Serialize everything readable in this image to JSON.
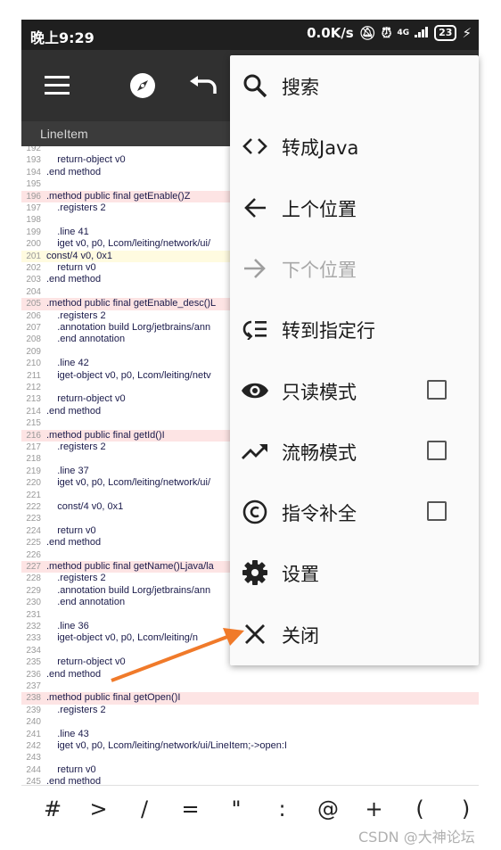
{
  "status": {
    "time": "晚上9:29",
    "speed": "0.0K/s",
    "network": "4G",
    "battery": "23"
  },
  "tab": {
    "label": "LineItem"
  },
  "code_lines": [
    {
      "n": "192",
      "t": "",
      "h": ""
    },
    {
      "n": "193",
      "t": "    return-object v0",
      "h": ""
    },
    {
      "n": "194",
      "t": ".end method",
      "h": ""
    },
    {
      "n": "195",
      "t": "",
      "h": ""
    },
    {
      "n": "196",
      "t": ".method public final getEnable()Z",
      "h": "pink"
    },
    {
      "n": "197",
      "t": "    .registers 2",
      "h": ""
    },
    {
      "n": "198",
      "t": "",
      "h": ""
    },
    {
      "n": "199",
      "t": "    .line 41",
      "h": ""
    },
    {
      "n": "200",
      "t": "    iget v0, p0, Lcom/leiting/network/ui/",
      "h": ""
    },
    {
      "n": "201",
      "t": "const/4 v0, 0x1",
      "h": "yellow"
    },
    {
      "n": "202",
      "t": "    return v0",
      "h": ""
    },
    {
      "n": "203",
      "t": ".end method",
      "h": ""
    },
    {
      "n": "204",
      "t": "",
      "h": ""
    },
    {
      "n": "205",
      "t": ".method public final getEnable_desc()L",
      "h": "pink"
    },
    {
      "n": "206",
      "t": "    .registers 2",
      "h": ""
    },
    {
      "n": "207",
      "t": "    .annotation build Lorg/jetbrains/ann",
      "h": ""
    },
    {
      "n": "208",
      "t": "    .end annotation",
      "h": ""
    },
    {
      "n": "209",
      "t": "",
      "h": ""
    },
    {
      "n": "210",
      "t": "    .line 42",
      "h": ""
    },
    {
      "n": "211",
      "t": "    iget-object v0, p0, Lcom/leiting/netv",
      "h": ""
    },
    {
      "n": "212",
      "t": "",
      "h": ""
    },
    {
      "n": "213",
      "t": "    return-object v0",
      "h": ""
    },
    {
      "n": "214",
      "t": ".end method",
      "h": ""
    },
    {
      "n": "215",
      "t": "",
      "h": ""
    },
    {
      "n": "216",
      "t": ".method public final getId()I",
      "h": "pink"
    },
    {
      "n": "217",
      "t": "    .registers 2",
      "h": ""
    },
    {
      "n": "218",
      "t": "",
      "h": ""
    },
    {
      "n": "219",
      "t": "    .line 37",
      "h": ""
    },
    {
      "n": "220",
      "t": "    iget v0, p0, Lcom/leiting/network/ui/",
      "h": ""
    },
    {
      "n": "221",
      "t": "",
      "h": ""
    },
    {
      "n": "222",
      "t": "    const/4 v0, 0x1",
      "h": ""
    },
    {
      "n": "223",
      "t": "",
      "h": ""
    },
    {
      "n": "224",
      "t": "    return v0",
      "h": ""
    },
    {
      "n": "225",
      "t": ".end method",
      "h": ""
    },
    {
      "n": "226",
      "t": "",
      "h": ""
    },
    {
      "n": "227",
      "t": ".method public final getName()Ljava/la",
      "h": "pink"
    },
    {
      "n": "228",
      "t": "    .registers 2",
      "h": ""
    },
    {
      "n": "229",
      "t": "    .annotation build Lorg/jetbrains/ann",
      "h": ""
    },
    {
      "n": "230",
      "t": "    .end annotation",
      "h": ""
    },
    {
      "n": "231",
      "t": "",
      "h": ""
    },
    {
      "n": "232",
      "t": "    .line 36",
      "h": ""
    },
    {
      "n": "233",
      "t": "    iget-object v0, p0, Lcom/leiting/n",
      "h": ""
    },
    {
      "n": "234",
      "t": "",
      "h": ""
    },
    {
      "n": "235",
      "t": "    return-object v0",
      "h": ""
    },
    {
      "n": "236",
      "t": ".end method",
      "h": ""
    },
    {
      "n": "237",
      "t": "",
      "h": ""
    },
    {
      "n": "238",
      "t": ".method public final getOpen()I",
      "h": "pink"
    },
    {
      "n": "239",
      "t": "    .registers 2",
      "h": ""
    },
    {
      "n": "240",
      "t": "",
      "h": ""
    },
    {
      "n": "241",
      "t": "    .line 43",
      "h": ""
    },
    {
      "n": "242",
      "t": "    iget v0, p0, Lcom/leiting/network/ui/LineItem;->open:I",
      "h": ""
    },
    {
      "n": "243",
      "t": "",
      "h": ""
    },
    {
      "n": "244",
      "t": "    return v0",
      "h": ""
    },
    {
      "n": "245",
      "t": ".end method",
      "h": ""
    }
  ],
  "menu": [
    {
      "label": "搜索",
      "icon": "search-icon",
      "disabled": false,
      "checkbox": false
    },
    {
      "label": "转成Java",
      "icon": "code-icon",
      "disabled": false,
      "checkbox": false
    },
    {
      "label": "上个位置",
      "icon": "arrow-left-icon",
      "disabled": false,
      "checkbox": false
    },
    {
      "label": "下个位置",
      "icon": "arrow-right-icon",
      "disabled": true,
      "checkbox": false
    },
    {
      "label": "转到指定行",
      "icon": "goto-line-icon",
      "disabled": false,
      "checkbox": false
    },
    {
      "label": "只读模式",
      "icon": "eye-icon",
      "disabled": false,
      "checkbox": true
    },
    {
      "label": "流畅模式",
      "icon": "trending-up-icon",
      "disabled": false,
      "checkbox": true
    },
    {
      "label": "指令补全",
      "icon": "copyright-icon",
      "disabled": false,
      "checkbox": true
    },
    {
      "label": "设置",
      "icon": "gear-icon",
      "disabled": false,
      "checkbox": false
    },
    {
      "label": "关闭",
      "icon": "close-icon",
      "disabled": false,
      "checkbox": false
    }
  ],
  "keys": [
    "#",
    ">",
    "/",
    "=",
    "\"",
    ":",
    "@",
    "+",
    "(",
    ")"
  ],
  "watermark": "CSDN @大神论坛",
  "colors": {
    "toolbar": "#303030",
    "menu_bg": "#fafafa",
    "arrow": "#f07a2a"
  }
}
